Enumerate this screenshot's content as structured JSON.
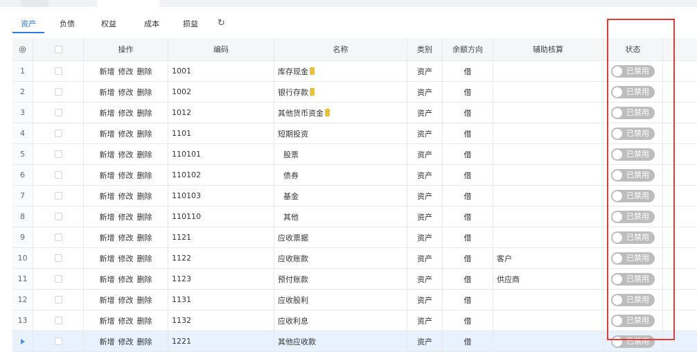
{
  "tabs": [
    "资产",
    "负债",
    "权益",
    "成本",
    "损益"
  ],
  "refresh_icon": "↻",
  "columns": {
    "settings_icon": "gear-icon",
    "operations": "操作",
    "code": "编码",
    "name": "名称",
    "category": "类别",
    "balance_direction": "余额方向",
    "aux_accounting": "辅助核算",
    "status": "状态"
  },
  "actions": {
    "add": "新增",
    "edit": "修改",
    "delete": "删除"
  },
  "rows": [
    {
      "index": "1",
      "code": "1001",
      "name": "库存现金",
      "coin": true,
      "indent": false,
      "category": "资产",
      "direction": "借",
      "aux": "",
      "status": "已禁用"
    },
    {
      "index": "2",
      "code": "1002",
      "name": "银行存款",
      "coin": true,
      "indent": false,
      "category": "资产",
      "direction": "借",
      "aux": "",
      "status": "已禁用"
    },
    {
      "index": "3",
      "code": "1012",
      "name": "其他货币资金",
      "coin": true,
      "indent": false,
      "category": "资产",
      "direction": "借",
      "aux": "",
      "status": "已禁用"
    },
    {
      "index": "4",
      "code": "1101",
      "name": "短期投资",
      "coin": false,
      "indent": false,
      "category": "资产",
      "direction": "借",
      "aux": "",
      "status": "已禁用"
    },
    {
      "index": "5",
      "code": "110101",
      "name": "股票",
      "coin": false,
      "indent": true,
      "category": "资产",
      "direction": "借",
      "aux": "",
      "status": "已禁用"
    },
    {
      "index": "6",
      "code": "110102",
      "name": "债券",
      "coin": false,
      "indent": true,
      "category": "资产",
      "direction": "借",
      "aux": "",
      "status": "已禁用"
    },
    {
      "index": "7",
      "code": "110103",
      "name": "基金",
      "coin": false,
      "indent": true,
      "category": "资产",
      "direction": "借",
      "aux": "",
      "status": "已禁用"
    },
    {
      "index": "8",
      "code": "110110",
      "name": "其他",
      "coin": false,
      "indent": true,
      "category": "资产",
      "direction": "借",
      "aux": "",
      "status": "已禁用"
    },
    {
      "index": "9",
      "code": "1121",
      "name": "应收票据",
      "coin": false,
      "indent": false,
      "category": "资产",
      "direction": "借",
      "aux": "",
      "status": "已禁用"
    },
    {
      "index": "10",
      "code": "1122",
      "name": "应收账款",
      "coin": false,
      "indent": false,
      "category": "资产",
      "direction": "借",
      "aux": "客户",
      "status": "已禁用"
    },
    {
      "index": "11",
      "code": "1123",
      "name": "预付账款",
      "coin": false,
      "indent": false,
      "category": "资产",
      "direction": "借",
      "aux": "供应商",
      "status": "已禁用"
    },
    {
      "index": "12",
      "code": "1131",
      "name": "应收股利",
      "coin": false,
      "indent": false,
      "category": "资产",
      "direction": "借",
      "aux": "",
      "status": "已禁用"
    },
    {
      "index": "13",
      "code": "1132",
      "name": "应收利息",
      "coin": false,
      "indent": false,
      "category": "资产",
      "direction": "借",
      "aux": "",
      "status": "已禁用"
    },
    {
      "index": "",
      "code": "1221",
      "name": "其他应收款",
      "coin": false,
      "indent": false,
      "category": "资产",
      "direction": "借",
      "aux": "",
      "status": "已禁用",
      "current": true
    }
  ],
  "colors": {
    "accent": "#2a7ae2",
    "toggle_off": "#bdbdbd",
    "highlight": "#e53935",
    "current_row": "#e8f2fe"
  }
}
